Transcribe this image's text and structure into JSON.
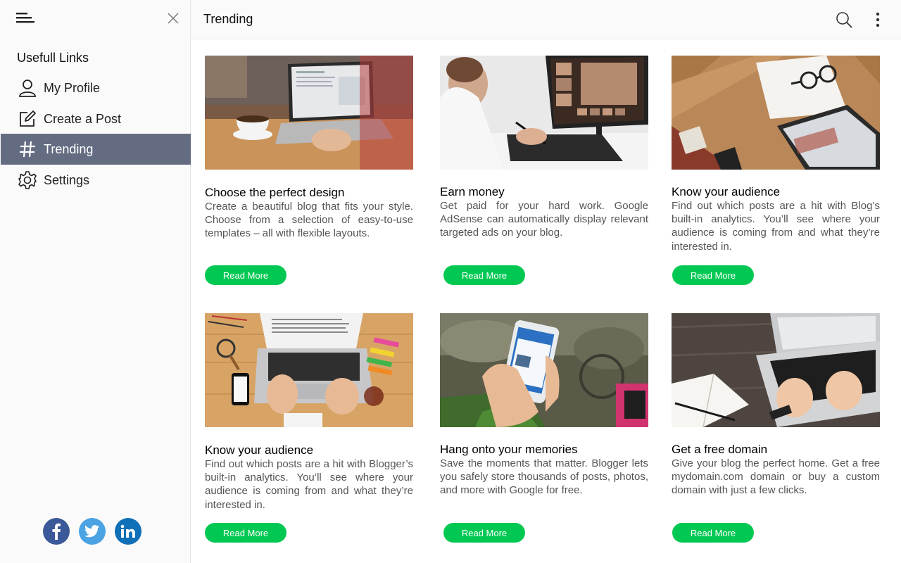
{
  "sidebar": {
    "heading": "Usefull Links",
    "items": [
      {
        "label": "My Profile",
        "icon": "user-icon"
      },
      {
        "label": "Create a Post",
        "icon": "edit-icon"
      },
      {
        "label": "Trending",
        "icon": "hash-icon",
        "active": true
      },
      {
        "label": "Settings",
        "icon": "gear-icon"
      }
    ],
    "social": [
      {
        "icon": "facebook-icon",
        "color": "#3b5998"
      },
      {
        "icon": "twitter-icon",
        "color": "#4ba3e3"
      },
      {
        "icon": "linkedin-icon",
        "color": "#1070b7"
      }
    ]
  },
  "header": {
    "title": "Trending"
  },
  "colors": {
    "active_nav": "#646c82",
    "button": "#00c853"
  },
  "cards": [
    {
      "title": "Choose the perfect design",
      "text": "Create a beautiful blog that fits your style. Choose from a selection of easy-to-use templates – all with flexible layouts.",
      "button": "Read More"
    },
    {
      "title": "Earn money",
      "text": "Get paid for your hard work. Google AdSense can automatically display relevant targeted ads on your blog.",
      "button": "Read More"
    },
    {
      "title": "Know your audience",
      "text": "Find out which posts are a hit with Blog’s built-in analytics. You’ll see where your audience is coming from and what they’re interested in.",
      "button": "Read More"
    },
    {
      "title": "Know your audience",
      "text": "Find out which posts are a hit with Blogger’s built-in analytics. You’ll see where your audience is coming from and what they’re interested in.",
      "button": "Read More"
    },
    {
      "title": "Hang onto your memories",
      "text": "Save the moments that matter. Blogger lets you safely store thousands of posts, photos, and more with Google for free.",
      "button": "Read More"
    },
    {
      "title": "Get a free domain",
      "text": "Give your blog the perfect home. Get a free mydomain.com domain or buy a custom domain with just a few clicks.",
      "button": "Read More"
    }
  ]
}
